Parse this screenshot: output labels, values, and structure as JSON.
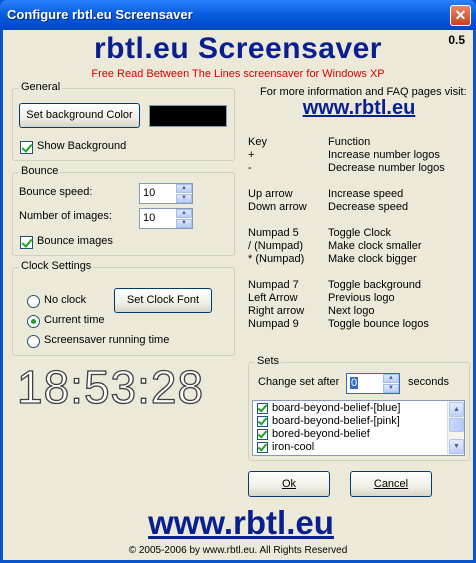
{
  "window": {
    "title": "Configure rbtl.eu Screensaver",
    "close_glyph": "✕"
  },
  "header": {
    "version": "0.5",
    "app_title": "rbtl.eu Screensaver",
    "subtitle": "Free Read Between The Lines screensaver for Windows XP"
  },
  "general": {
    "legend": "General",
    "set_bg_button": "Set background Color",
    "bg_color": "#000000",
    "show_background_label": "Show Background",
    "show_background_checked": true
  },
  "bounce": {
    "legend": "Bounce",
    "speed_label": "Bounce speed:",
    "speed_value": "10",
    "images_label": "Number of images:",
    "images_value": "10",
    "bounce_images_label": "Bounce images",
    "bounce_images_checked": true
  },
  "clock": {
    "legend": "Clock Settings",
    "options": [
      "No clock",
      "Current time",
      "Screensaver running time"
    ],
    "selected": "Current time",
    "set_font_button": "Set Clock Font",
    "time_display": "18:53:28"
  },
  "info": {
    "more_info": "For more information and FAQ pages visit:",
    "url": "www.rbtl.eu"
  },
  "keys": {
    "header_key": "Key",
    "header_function": "Function",
    "rows": [
      {
        "key": "+",
        "function": "Increase number logos"
      },
      {
        "key": "-",
        "function": "Decrease number logos"
      },
      {
        "key": "Up arrow",
        "function": "Increase speed"
      },
      {
        "key": "Down arrow",
        "function": "Decrease speed"
      },
      {
        "key": "Numpad 5",
        "function": "Toggle Clock"
      },
      {
        "key": "/ (Numpad)",
        "function": "Make clock smaller"
      },
      {
        "key": "* (Numpad)",
        "function": "Make clock bigger"
      },
      {
        "key": "Numpad 7",
        "function": "Toggle background"
      },
      {
        "key": "Left Arrow",
        "function": "Previous logo"
      },
      {
        "key": "Right arrow",
        "function": "Next logo"
      },
      {
        "key": "Numpad 9",
        "function": "Toggle bounce logos"
      }
    ]
  },
  "sets": {
    "legend": "Sets",
    "change_label": "Change set after",
    "change_value": "0",
    "seconds_label": "seconds",
    "items": [
      {
        "label": "board-beyond-belief-[blue]",
        "checked": true
      },
      {
        "label": "board-beyond-belief-[pink]",
        "checked": true
      },
      {
        "label": "bored-beyond-belief",
        "checked": true
      },
      {
        "label": "iron-cool",
        "checked": true
      }
    ]
  },
  "buttons": {
    "ok": "Ok",
    "cancel": "Cancel"
  },
  "footer": {
    "url": "www.rbtl.eu",
    "copyright": "© 2005-2006 by www.rbtl.eu. All Rights Reserved"
  },
  "colors": {
    "title_blue": "#0a1f8f",
    "subtitle_red": "#e00000",
    "dialog_bg": "#ece9d8"
  }
}
